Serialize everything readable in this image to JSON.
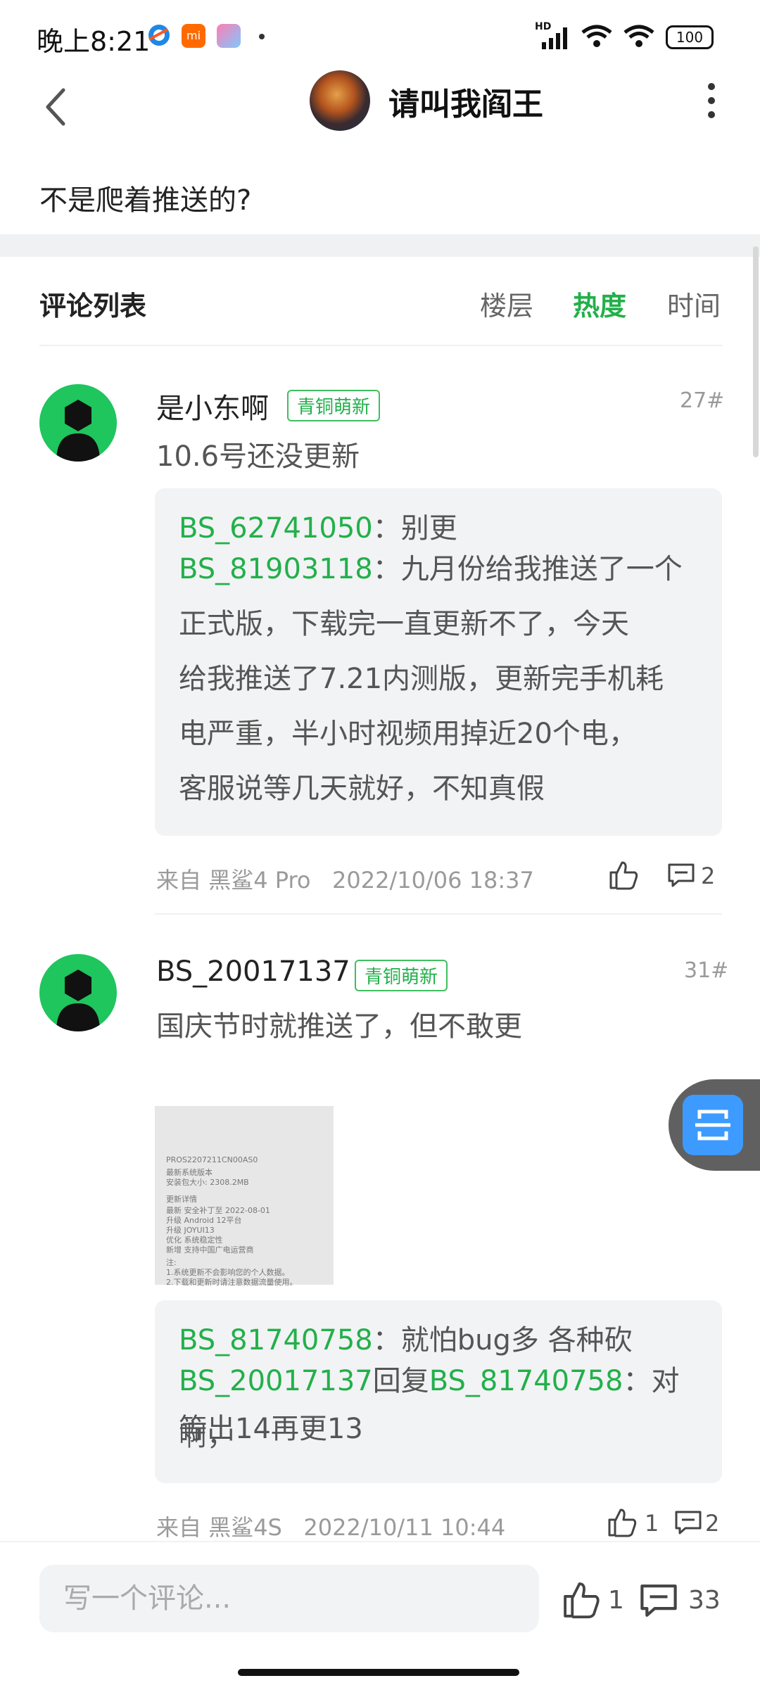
{
  "status_bar": {
    "time": "晚上8:21",
    "mi_label": "mi",
    "battery": "100",
    "signal": "HD"
  },
  "header": {
    "title": "请叫我阎王"
  },
  "post": {
    "tail_text": "不是爬着推送的?"
  },
  "comments_header": {
    "title": "评论列表",
    "sort_options": [
      "楼层",
      "热度",
      "时间"
    ],
    "active_sort": "热度"
  },
  "comments": [
    {
      "username": "是小东啊",
      "badge": "青铜萌新",
      "floor": "27#",
      "text": "10.6号还没更新",
      "replies": [
        {
          "name": "BS_62741050",
          "sep": "：",
          "text": "别更"
        },
        {
          "name": "BS_81903118",
          "sep": "：",
          "text_lines": [
            "九月份给我推送了一个",
            "正式版，下载完一直更新不了，今天",
            "给我推送了7.21内测版，更新完手机耗",
            "电严重，半小时视频用掉近20个电，",
            "客服说等几天就好，不知真假"
          ]
        }
      ],
      "meta_prefix": "来自",
      "device": "黑鲨4 Pro",
      "datetime": "2022/10/06 18:37",
      "likes": "",
      "reply_count": "2"
    },
    {
      "username": "BS_20017137",
      "badge": "青铜萌新",
      "floor": "31#",
      "text": "国庆节时就推送了，但不敢更",
      "image_lines": [
        "PROS2207211CN00AS0",
        "最新系统版本",
        "安装包大小: 2308.2MB",
        "更新详情",
        "最新 安全补丁至 2022-08-01",
        "升级 Android 12平台",
        "升级 JOYUI13",
        "优化 系统稳定性",
        "新增 支持中国广电运营商",
        "注:",
        "1.系统更新不会影响您的个人数据。",
        "2.下载和更新时请注意数据流量使用。"
      ],
      "replies": [
        {
          "name": "BS_81740758",
          "sep": "：",
          "text": "就怕bug多 各种砍"
        },
        {
          "name": "BS_20017137",
          "reply_word": "回复",
          "target": "BS_81740758",
          "sep": "：",
          "text_lines": [
            "对啊，",
            "等出14再更13"
          ]
        }
      ],
      "meta_prefix": "来自",
      "device": "黑鲨4S",
      "datetime": "2022/10/11 10:44",
      "likes": "1",
      "reply_count": "2"
    }
  ],
  "bottom_bar": {
    "input_placeholder": "写一个评论...",
    "likes": "1",
    "comments": "33"
  },
  "colors": {
    "accent_green": "#22b04a",
    "avatar_green": "#1fc55d",
    "float_blue": "#3d9bff"
  },
  "icons": [
    "back-arrow-icon",
    "more-vertical-icon",
    "thumb-up-icon",
    "comment-icon",
    "scan-translate-icon"
  ]
}
